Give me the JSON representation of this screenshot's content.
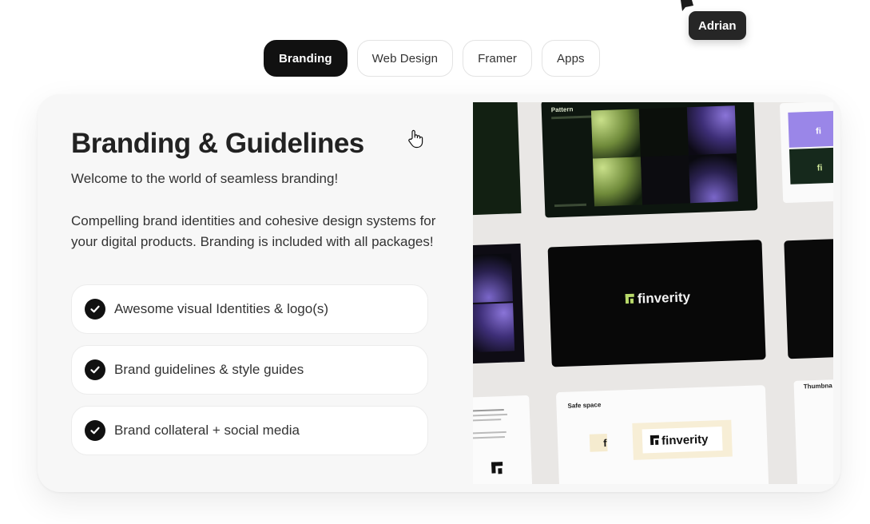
{
  "tabs": [
    {
      "label": "Branding",
      "active": true
    },
    {
      "label": "Web Design",
      "active": false
    },
    {
      "label": "Framer",
      "active": false
    },
    {
      "label": "Apps",
      "active": false
    }
  ],
  "collaborator": {
    "name": "Adrian"
  },
  "card": {
    "title": "Branding & Guidelines",
    "intro": "Welcome to the world of seamless branding!",
    "description": "Compelling brand identities and cohesive design systems for your digital products. Branding is included with all packages!",
    "features": [
      {
        "label": "Awesome visual Identities & logo(s)",
        "icon": "check-circle-icon"
      },
      {
        "label": "Brand guidelines & style guides",
        "icon": "check-circle-icon"
      },
      {
        "label": "Brand collateral + social media",
        "icon": "check-circle-icon"
      }
    ]
  },
  "preview": {
    "brand_name": "finverity",
    "pattern_label": "Pattern",
    "safe_space_label": "Safe space",
    "thumbnail_label": "Thumbna",
    "colors": {
      "dark": "#0b0d0b",
      "green": "#b8d96a",
      "purple": "#6a56b8",
      "canvas": "#e9e7e5"
    }
  },
  "colors": {
    "accent": "#111111",
    "card_bg": "#f7f7f7"
  }
}
